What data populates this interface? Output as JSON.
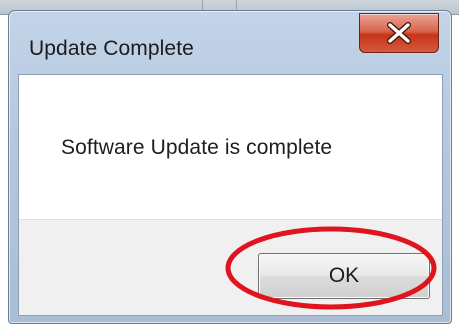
{
  "dialog": {
    "title": "Update Complete",
    "message": "Software Update is complete",
    "close_icon": "close-x-icon",
    "buttons": {
      "ok_label": "OK"
    }
  },
  "colors": {
    "close_button_red": "#c6341a",
    "annotation_red": "#e0141e",
    "title_bar_blue": "#b5c8df"
  }
}
